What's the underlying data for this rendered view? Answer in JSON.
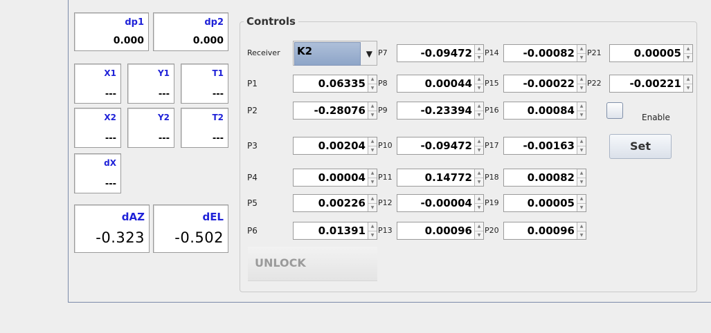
{
  "readouts": {
    "dp1": {
      "label": "dp1",
      "value": "0.000"
    },
    "dp2": {
      "label": "dp2",
      "value": "0.000"
    },
    "x1": {
      "label": "X1",
      "value": "---"
    },
    "y1": {
      "label": "Y1",
      "value": "---"
    },
    "t1": {
      "label": "T1",
      "value": "---"
    },
    "x2": {
      "label": "X2",
      "value": "---"
    },
    "y2": {
      "label": "Y2",
      "value": "---"
    },
    "t2": {
      "label": "T2",
      "value": "---"
    },
    "dx": {
      "label": "dX",
      "value": "---"
    },
    "daz": {
      "label": "dAZ",
      "value": "-0.323"
    },
    "del": {
      "label": "dEL",
      "value": "-0.502"
    }
  },
  "controls": {
    "title": "Controls",
    "receiver_label": "Receiver",
    "receiver_value": "K2",
    "enable_label": "Enable",
    "set_label": "Set",
    "unlock_label": "UNLOCK",
    "params": {
      "P1": "0.06335",
      "P2": "-0.28076",
      "P3": "0.00204",
      "P4": "0.00004",
      "P5": "0.00226",
      "P6": "0.01391",
      "P7": "-0.09472",
      "P8": "0.00044",
      "P9": "-0.23394",
      "P10": "-0.09472",
      "P11": "0.14772",
      "P12": "-0.00004",
      "P13": "0.00096",
      "P14": "-0.00082",
      "P15": "-0.00022",
      "P16": "0.00084",
      "P17": "-0.00163",
      "P18": "0.00082",
      "P19": "0.00005",
      "P20": "0.00096",
      "P21": "0.00005",
      "P22": "-0.00221"
    }
  },
  "icons": {
    "spinner_up": "triangle-up",
    "spinner_down": "triangle-down",
    "combo_arrow": "triangle-down"
  }
}
